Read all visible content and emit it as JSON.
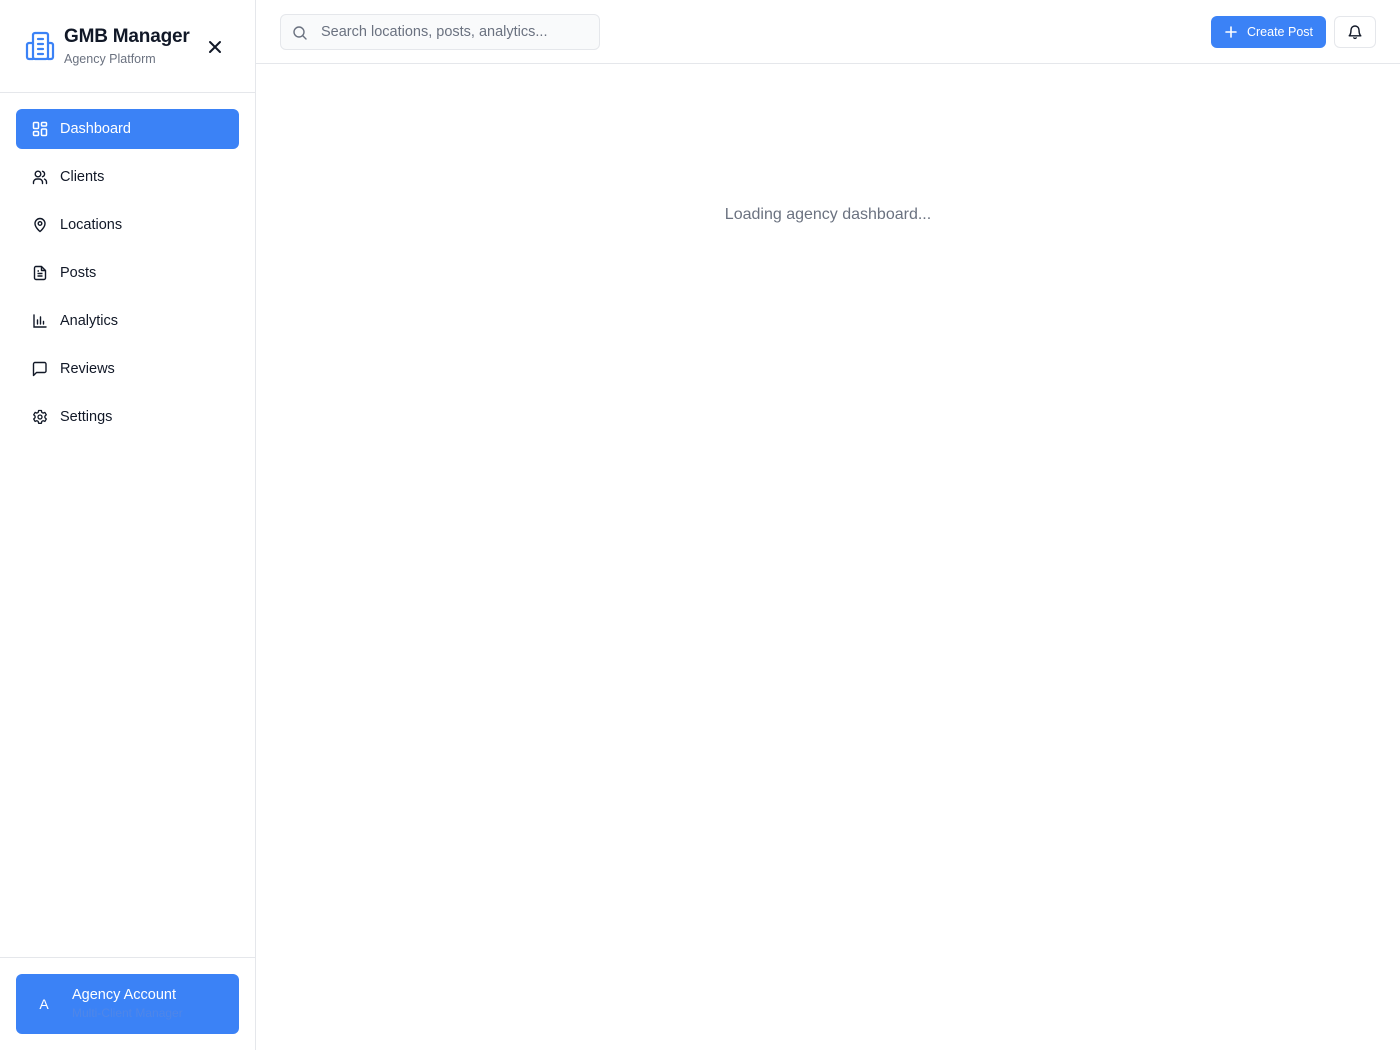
{
  "brand": {
    "title": "GMB Manager",
    "subtitle": "Agency Platform",
    "logo_icon": "building-icon",
    "close_icon": "close-icon"
  },
  "nav": {
    "items": [
      {
        "label": "Dashboard",
        "icon": "dashboard-grid-icon",
        "active": true
      },
      {
        "label": "Clients",
        "icon": "users-icon",
        "active": false
      },
      {
        "label": "Locations",
        "icon": "map-pin-icon",
        "active": false
      },
      {
        "label": "Posts",
        "icon": "file-text-icon",
        "active": false
      },
      {
        "label": "Analytics",
        "icon": "bar-chart-icon",
        "active": false
      },
      {
        "label": "Reviews",
        "icon": "message-square-icon",
        "active": false
      },
      {
        "label": "Settings",
        "icon": "gear-icon",
        "active": false
      }
    ]
  },
  "account": {
    "avatar_letter": "A",
    "name": "Agency Account",
    "role": "Multi-Client Manager"
  },
  "search": {
    "placeholder": "Search locations, posts, analytics...",
    "value": ""
  },
  "toolbar": {
    "create_label": "Create Post",
    "create_icon": "plus-icon",
    "bell_icon": "bell-icon"
  },
  "main": {
    "loading_text": "Loading agency dashboard..."
  },
  "colors": {
    "accent": "#3b82f6",
    "border": "#e5e7eb",
    "muted_text": "#6b7280",
    "text": "#111827"
  }
}
